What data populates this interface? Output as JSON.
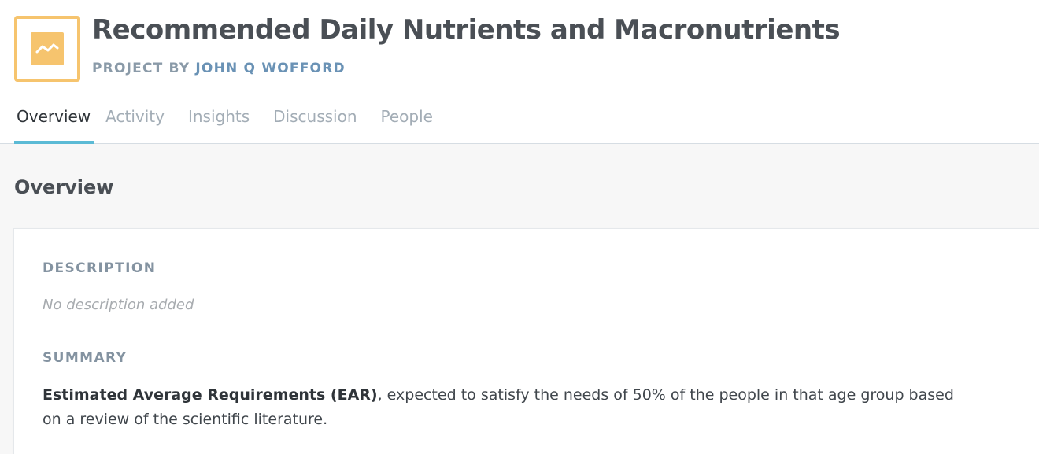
{
  "project": {
    "title": "Recommended Daily Nutrients and Macronutrients",
    "byline_prefix": "PROJECT BY",
    "author": "JOHN Q WOFFORD",
    "icon": "line-chart-icon"
  },
  "tabs": [
    {
      "label": "Overview",
      "active": true
    },
    {
      "label": "Activity",
      "active": false
    },
    {
      "label": "Insights",
      "active": false
    },
    {
      "label": "Discussion",
      "active": false
    },
    {
      "label": "People",
      "active": false
    }
  ],
  "overview": {
    "heading": "Overview",
    "description_label": "DESCRIPTION",
    "description_value": "No description added",
    "summary_label": "SUMMARY",
    "summary_bold": "Estimated Average Requirements (EAR)",
    "summary_rest": ", expected to satisfy the needs of 50% of the people in that age group based on a review of the scientific literature."
  },
  "colors": {
    "accent": "#5bbad5",
    "logo": "#f6c46e",
    "author_link": "#6a92b5"
  }
}
